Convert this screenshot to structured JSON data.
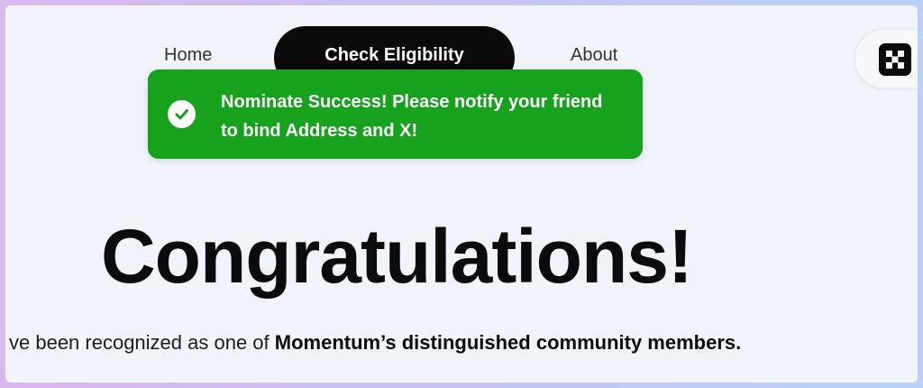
{
  "nav": {
    "home_label": "Home",
    "check_eligibility_label": "Check Eligibility",
    "about_label": "About"
  },
  "wallet": {
    "logo_icon": "x-logo-icon"
  },
  "toast": {
    "icon": "check-circle-icon",
    "message": "Nominate Success! Please notify your friend to bind Address and X!",
    "color": "#16a21d"
  },
  "main": {
    "heading": "Congratulations!",
    "recognition_prefix": "ve been recognized as one of ",
    "recognition_bold": "Momentum’s distinguished community members."
  }
}
